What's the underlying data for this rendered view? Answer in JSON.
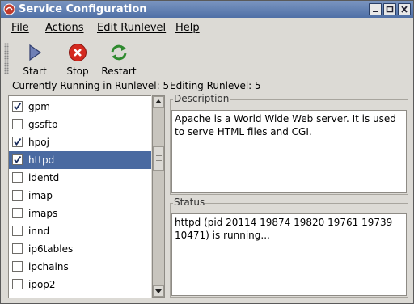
{
  "window": {
    "title": "Service Configuration",
    "controls": [
      "minimize-icon",
      "maximize-icon",
      "close-icon"
    ]
  },
  "menu": {
    "file": {
      "mnemonic": "F",
      "rest": "ile"
    },
    "actions": {
      "mnemonic": "A",
      "rest": "ctions"
    },
    "edit_runlevel": {
      "mnemonic": "E",
      "rest": "dit Runlevel"
    },
    "help": {
      "mnemonic": "H",
      "rest": "elp"
    }
  },
  "toolbar": {
    "start": {
      "label": "Start",
      "icon": "play-icon"
    },
    "stop": {
      "label": "Stop",
      "icon": "stop-icon"
    },
    "restart": {
      "label": "Restart",
      "icon": "refresh-icon"
    }
  },
  "status_line": {
    "current": "Currently Running in Runlevel: 5",
    "editing": "Editing Runlevel: 5"
  },
  "services": [
    {
      "name": "gpm",
      "enabled": true,
      "selected": false
    },
    {
      "name": "gssftp",
      "enabled": false,
      "selected": false
    },
    {
      "name": "hpoj",
      "enabled": true,
      "selected": false
    },
    {
      "name": "httpd",
      "enabled": true,
      "selected": true
    },
    {
      "name": "identd",
      "enabled": false,
      "selected": false
    },
    {
      "name": "imap",
      "enabled": false,
      "selected": false
    },
    {
      "name": "imaps",
      "enabled": false,
      "selected": false
    },
    {
      "name": "innd",
      "enabled": false,
      "selected": false
    },
    {
      "name": "ip6tables",
      "enabled": false,
      "selected": false
    },
    {
      "name": "ipchains",
      "enabled": false,
      "selected": false
    },
    {
      "name": "ipop2",
      "enabled": false,
      "selected": false
    }
  ],
  "description": {
    "label": "Description",
    "text": "Apache is a World Wide Web server.  It is used to serve HTML files and CGI."
  },
  "status": {
    "label": "Status",
    "text": "httpd (pid 20114 19874 19820 19761 19739 10471) is running..."
  },
  "colors": {
    "titlebar": "#4f6fa6",
    "selection": "#4a6aa1",
    "window_bg": "#dcdad5"
  }
}
